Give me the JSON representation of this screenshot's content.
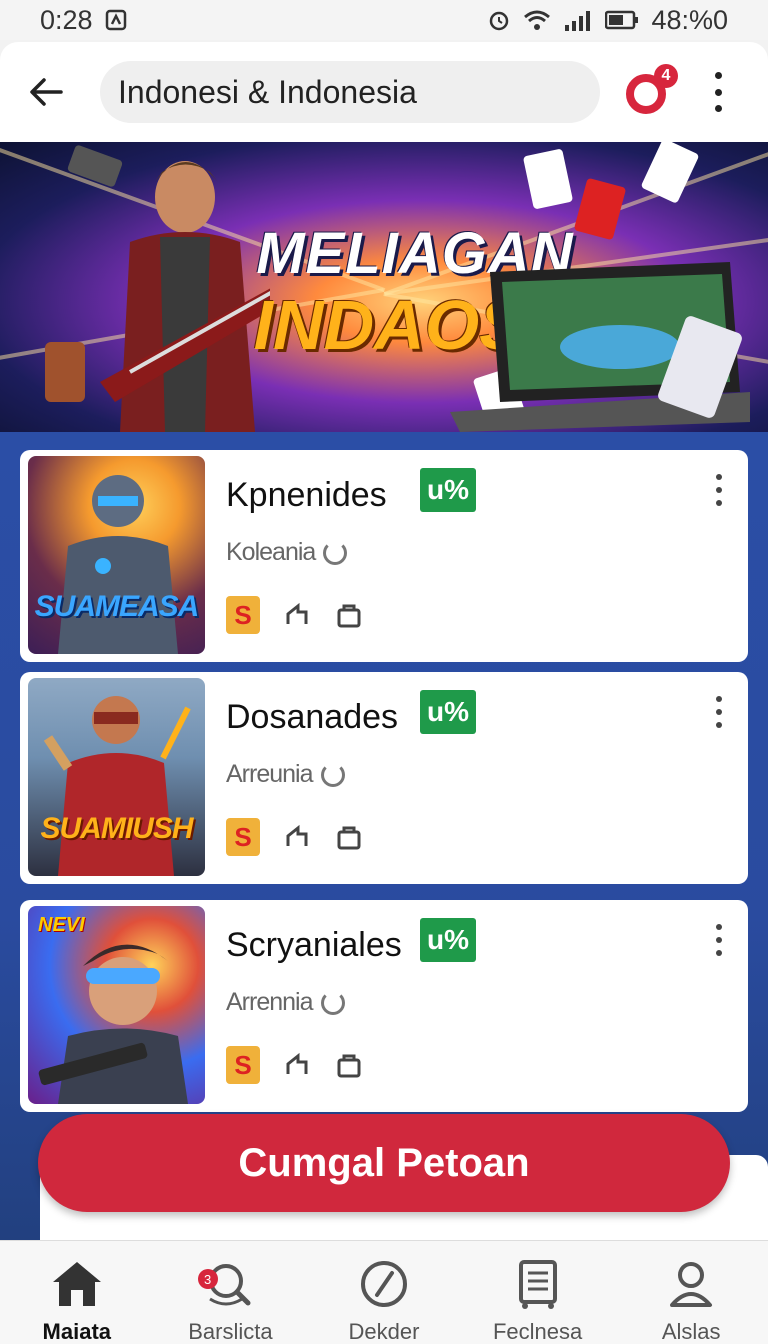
{
  "status_bar": {
    "time": "0:28",
    "battery": "48:%0"
  },
  "app_bar": {
    "search_value": "Indonesi & Indonesia",
    "notification_count": "4"
  },
  "banner": {
    "line1": "MELIAGAN",
    "line2": "INDAOSA"
  },
  "items": [
    {
      "title": "Kpnenides",
      "badge": "u%",
      "subtitle": "Koleania",
      "thumb_label": "SUAMEASA",
      "app_icon": "S",
      "thumb_colors": [
        "#f59a2e",
        "#3c1e56"
      ]
    },
    {
      "title": "Dosanades",
      "badge": "u%",
      "subtitle": "Arreunia",
      "thumb_label": "SUAMIUSH",
      "app_icon": "S",
      "thumb_colors": [
        "#6f8fb0",
        "#2d3040"
      ]
    },
    {
      "title": "Scryaniales",
      "badge": "u%",
      "subtitle": "Arrennia",
      "thumb_label": "",
      "thumb_tag": "NEVI",
      "app_icon": "S",
      "thumb_colors": [
        "#3a6cf0",
        "#6a1f8a"
      ]
    }
  ],
  "cta": {
    "label": "Cumgal Petoan"
  },
  "bottom_nav": [
    {
      "label": "Maiata",
      "icon": "home-icon",
      "active": true
    },
    {
      "label": "Barslicta",
      "icon": "search-alert-icon",
      "badge": "3"
    },
    {
      "label": "Dekder",
      "icon": "compass-icon"
    },
    {
      "label": "Feclnesa",
      "icon": "receipt-icon"
    },
    {
      "label": "Alslas",
      "icon": "profile-icon"
    }
  ],
  "colors": {
    "accent": "#d0283d",
    "badge_green": "#1f9a4a",
    "content_bg": "#2b4ea6"
  }
}
